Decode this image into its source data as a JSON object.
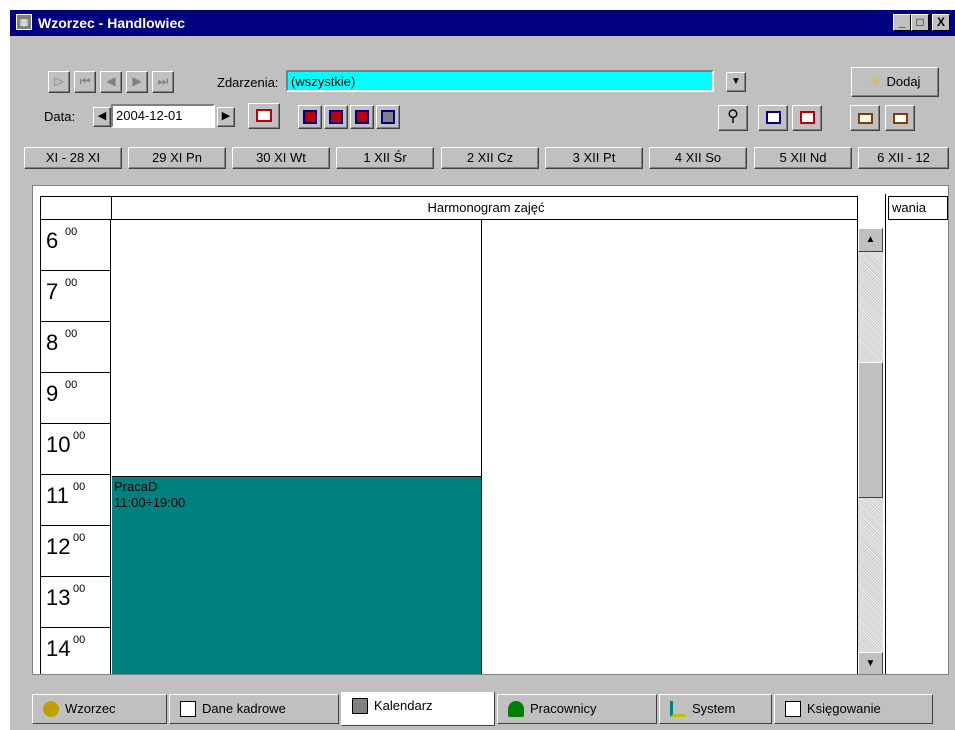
{
  "window": {
    "title": "Wzorzec - Handlowiec",
    "controls": [
      "_",
      "□",
      "X"
    ]
  },
  "toolbar": {
    "zdarzenia_label": "Zdarzenia:",
    "zdarzenia_value": "(wszystkie)",
    "dodaj_label": "Dodaj",
    "data_label": "Data:",
    "date_value": "2004-12-01"
  },
  "days": [
    "XI - 28 XI",
    "29 XI Pn",
    "30 XI Wt",
    "1 XII Śr",
    "2 XII Cz",
    "3 XII Pt",
    "4 XII So",
    "5 XII Nd",
    "6 XII - 12"
  ],
  "schedule": {
    "header": "Harmonogram zajęć",
    "side_header": "wania",
    "minute_suffix": "00",
    "hours": [
      "6",
      "7",
      "8",
      "9",
      "10",
      "11",
      "12",
      "13",
      "14"
    ],
    "event": {
      "title": "PracaD",
      "time": "11:00÷19:00",
      "color": "#008080"
    }
  },
  "tabs": [
    {
      "label": "Wzorzec",
      "icon": "people-icon"
    },
    {
      "label": "Dane kadrowe",
      "icon": "document-icon"
    },
    {
      "label": "Kalendarz",
      "icon": "calendar-icon",
      "active": true
    },
    {
      "label": "Pracownicy",
      "icon": "person-icon"
    },
    {
      "label": "System",
      "icon": "tree-icon"
    },
    {
      "label": "Księgowanie",
      "icon": "ledger-icon"
    }
  ],
  "colors": {
    "titlebar": "#000080",
    "combo_bg": "#00ffff",
    "face": "#c0c0c0"
  }
}
